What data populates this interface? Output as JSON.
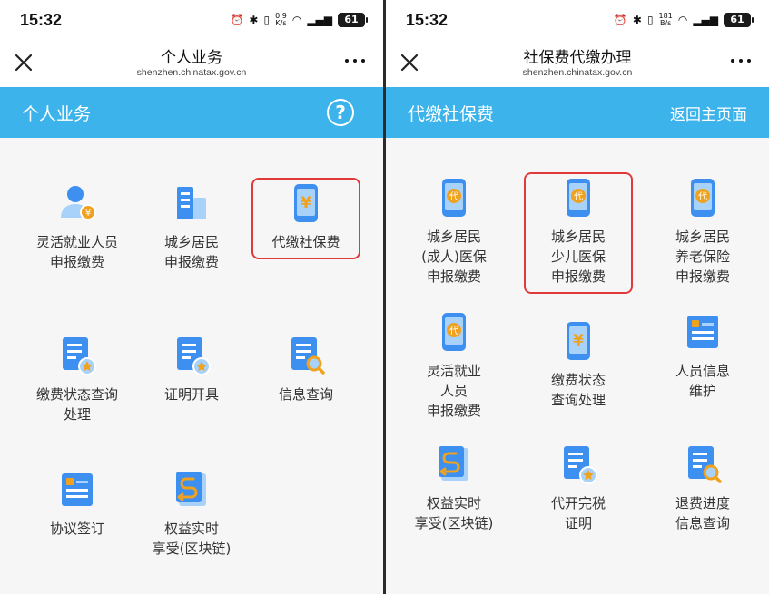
{
  "left": {
    "status": {
      "time": "15:32",
      "net_speed_top": "0.9",
      "net_speed_bottom": "K/s",
      "battery": "61"
    },
    "navbar": {
      "title": "个人业务",
      "url": "shenzhen.chinatax.gov.cn"
    },
    "banner": {
      "title": "个人业务",
      "help": "?"
    },
    "tiles": [
      {
        "icon": "person-coin-icon",
        "lines": [
          "灵活就业人员",
          "申报缴费"
        ]
      },
      {
        "icon": "buildings-icon",
        "lines": [
          "城乡居民",
          "申报缴费"
        ]
      },
      {
        "icon": "phone-yuan-icon",
        "lines": [
          "代缴社保费"
        ],
        "highlighted": true
      },
      {
        "icon": "document-star-icon",
        "lines": [
          "缴费状态查询",
          "处理"
        ]
      },
      {
        "icon": "document-star-icon",
        "lines": [
          "证明开具"
        ]
      },
      {
        "icon": "document-search-icon",
        "lines": [
          "信息查询"
        ]
      },
      {
        "icon": "id-card-icon",
        "lines": [
          "协议签订"
        ]
      },
      {
        "icon": "blockchain-book-icon",
        "lines": [
          "权益实时",
          "享受(区块链)"
        ]
      }
    ]
  },
  "right": {
    "status": {
      "time": "15:32",
      "net_speed_top": "181",
      "net_speed_bottom": "B/s",
      "battery": "61"
    },
    "navbar": {
      "title": "社保费代缴办理",
      "url": "shenzhen.chinatax.gov.cn"
    },
    "banner": {
      "title": "代缴社保费",
      "link": "返回主页面"
    },
    "tiles": [
      {
        "icon": "phone-dai-icon",
        "lines": [
          "城乡居民",
          "(成人)医保",
          "申报缴费"
        ]
      },
      {
        "icon": "phone-dai-icon",
        "lines": [
          "城乡居民",
          "少儿医保",
          "申报缴费"
        ],
        "highlighted": true
      },
      {
        "icon": "phone-dai-icon",
        "lines": [
          "城乡居民",
          "养老保险",
          "申报缴费"
        ]
      },
      {
        "icon": "phone-dai-icon",
        "lines": [
          "灵活就业",
          "人员",
          "申报缴费"
        ]
      },
      {
        "icon": "phone-yuan-icon",
        "lines": [
          "缴费状态",
          "查询处理"
        ]
      },
      {
        "icon": "id-card-icon",
        "lines": [
          "人员信息",
          "维护"
        ]
      },
      {
        "icon": "blockchain-book-icon",
        "lines": [
          "权益实时",
          "享受(区块链)"
        ]
      },
      {
        "icon": "document-star-icon",
        "lines": [
          "代开完税",
          "证明"
        ]
      },
      {
        "icon": "document-search-icon",
        "lines": [
          "退费进度",
          "信息查询"
        ]
      }
    ]
  },
  "colors": {
    "banner": "#3cb3ea",
    "icon_blue": "#3d8ff0",
    "icon_light": "#a9d2fb",
    "coin": "#f0a21e",
    "highlight": "#e03a3a"
  }
}
